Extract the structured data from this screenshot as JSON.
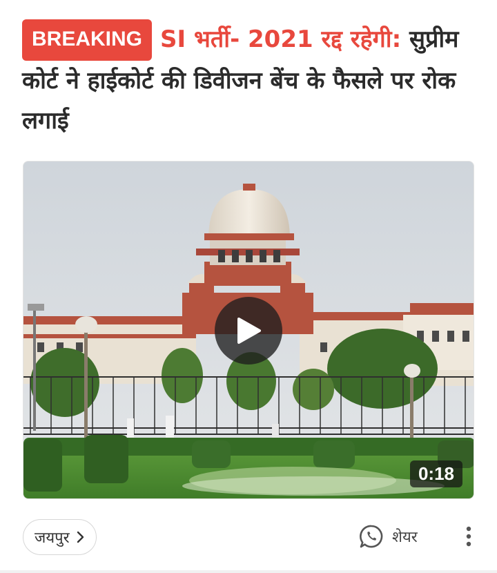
{
  "article": {
    "badge": "BREAKING",
    "headline_highlight": "SI भर्ती- 2021 रद्द रहेगी:",
    "headline_rest": "सुप्रीम कोर्ट ने हाईकोर्ट की डिवीजन बेंच के फैसले पर रोक लगाई"
  },
  "video": {
    "duration": "0:18",
    "play_icon": "play-icon"
  },
  "footer": {
    "location": "जयपुर",
    "location_icon": "chevron-right-icon",
    "share_label": "शेयर",
    "share_icon": "whatsapp-icon",
    "more_icon": "more-vertical-icon"
  },
  "colors": {
    "accent": "#e8483d",
    "text": "#2b2b2b"
  }
}
